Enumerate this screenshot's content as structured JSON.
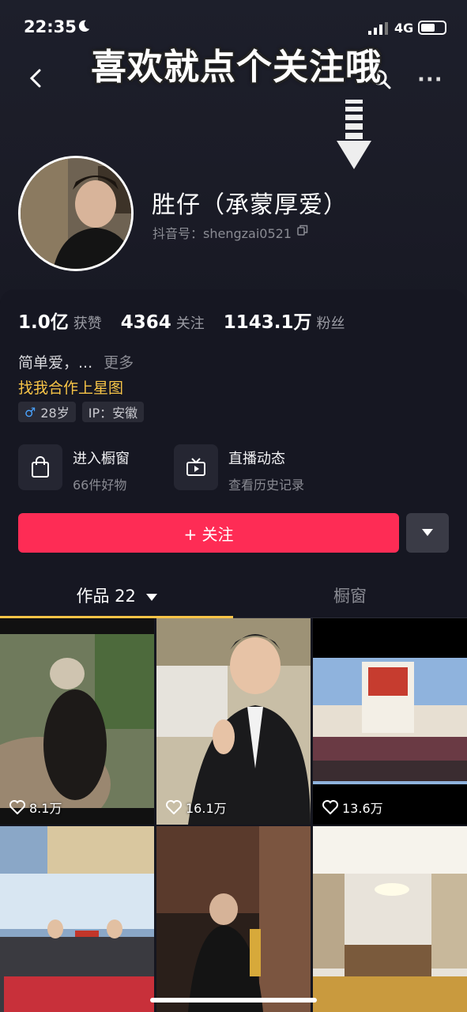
{
  "status_bar": {
    "time": "22:35",
    "network": "4G",
    "battery_level": 0.6
  },
  "overlay": {
    "banner_text": "喜欢就点个关注哦"
  },
  "profile": {
    "name": "胜仔（承蒙厚爱）",
    "douyin_id": "抖音号：shengzai0521"
  },
  "stats": [
    {
      "value": "1.0亿",
      "label": "获赞"
    },
    {
      "value": "4364",
      "label": "关注"
    },
    {
      "value": "1143.1万",
      "label": "粉丝"
    }
  ],
  "bio": {
    "text": "简单爱，...",
    "more": "更多",
    "link": "找我合作上星图"
  },
  "tags": {
    "gender_age": "28岁",
    "ip": "IP：安徽"
  },
  "quick_actions": [
    {
      "title": "进入橱窗",
      "subtitle": "66件好物",
      "icon": "shopping-bag-icon"
    },
    {
      "title": "直播动态",
      "subtitle": "查看历史记录",
      "icon": "tv-icon"
    }
  ],
  "follow_button": {
    "label": "+ 关注"
  },
  "tabs": {
    "works": "作品 22",
    "window": "橱窗"
  },
  "posts": [
    {
      "likes": "8.1万"
    },
    {
      "likes": "16.1万"
    },
    {
      "likes": "13.6万"
    },
    {
      "likes": ""
    },
    {
      "likes": ""
    },
    {
      "likes": ""
    }
  ],
  "colors": {
    "accent": "#fe2c55",
    "link": "#f7c447",
    "background": "#161722"
  }
}
